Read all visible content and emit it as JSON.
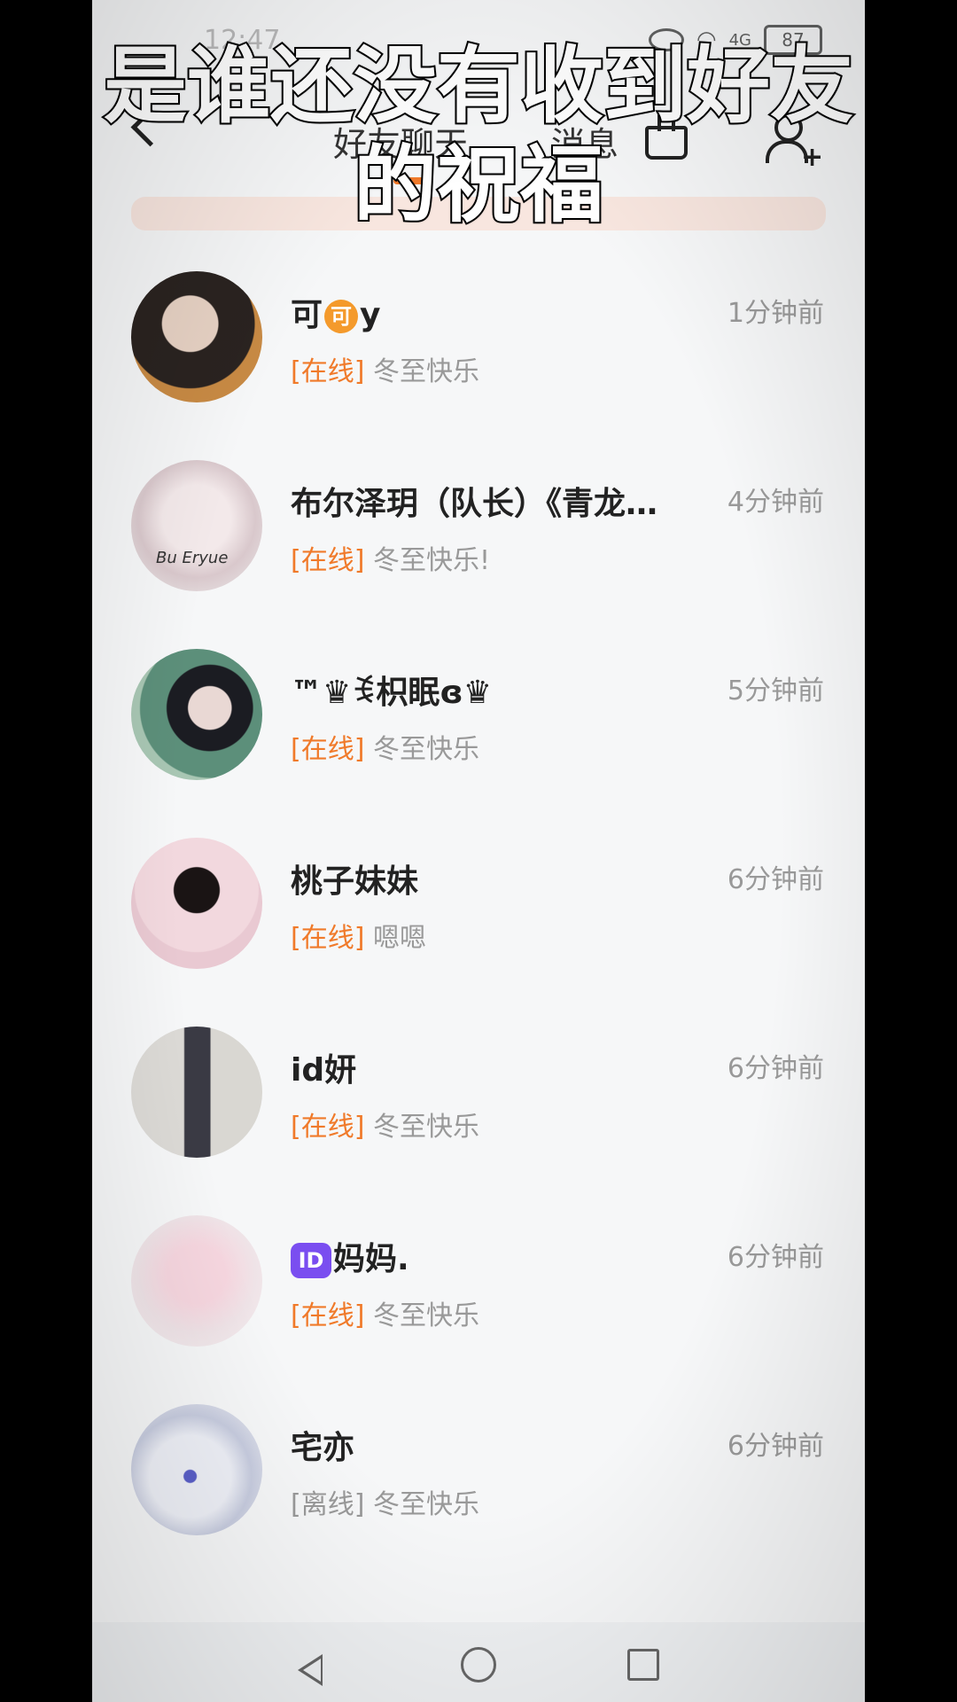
{
  "status_bar": {
    "time": "12:47",
    "battery": "87",
    "network": "4G"
  },
  "header": {
    "tab_friends": "好友聊天",
    "tab_messages": "消息"
  },
  "caption": {
    "line1": "是谁还没有收到好友",
    "line2": "的祝福"
  },
  "chats": [
    {
      "name_prefix": "可",
      "badge": "可",
      "name_suffix": "y",
      "time": "1分钟前",
      "status": "[在线]",
      "message": "冬至快乐"
    },
    {
      "name": "布尔泽玥（队长）《青龙…",
      "time": "4分钟前",
      "status": "[在线]",
      "message": "冬至快乐!",
      "avatar_text": "Bu Eryue"
    },
    {
      "name": "™♛ꉂ枳眠ɞ♛",
      "time": "5分钟前",
      "status": "[在线]",
      "message": "冬至快乐"
    },
    {
      "name": "桃子妹妹",
      "time": "6分钟前",
      "status": "[在线]",
      "message": "嗯嗯"
    },
    {
      "name": "id妍",
      "time": "6分钟前",
      "status": "[在线]",
      "message": "冬至快乐"
    },
    {
      "badge": "ID",
      "name": "妈妈.",
      "time": "6分钟前",
      "status": "[在线]",
      "message": "冬至快乐"
    },
    {
      "name": "宅亦",
      "time": "6分钟前",
      "status": "[离线]",
      "message": "冬至快乐"
    }
  ],
  "colors": {
    "accent": "#f07a2a",
    "muted": "#999999",
    "badge_id": "#7a4ef0"
  }
}
